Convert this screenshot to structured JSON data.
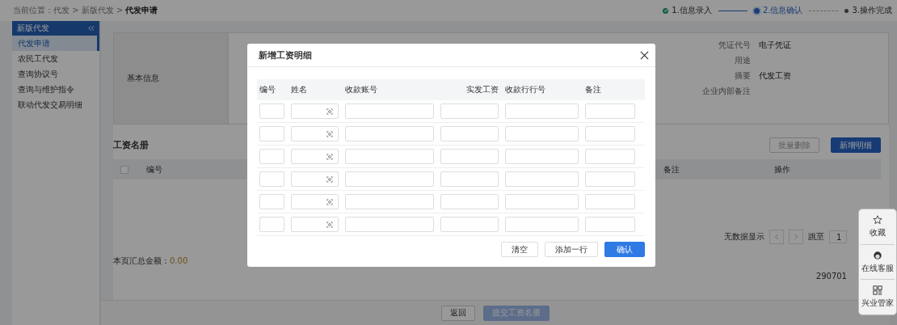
{
  "breadcrumb": {
    "trail": "当前位置：代发 > 新版代发 >",
    "current": "代发申请"
  },
  "steps": [
    {
      "label": "1.信息录入",
      "completed": true,
      "selected": false
    },
    {
      "label": "2.信息确认",
      "completed": false,
      "selected": true
    },
    {
      "label": "3.操作完成",
      "completed": false,
      "selected": false
    }
  ],
  "sidebar": {
    "title": "新版代发",
    "items": [
      {
        "label": "代发申请",
        "selected": true
      },
      {
        "label": "农民工代发",
        "selected": false
      },
      {
        "label": "查询协议号",
        "selected": false
      },
      {
        "label": "查询与维护指令",
        "selected": false
      },
      {
        "label": "联动代发交易明细",
        "selected": false
      }
    ]
  },
  "basic_info": {
    "label": "基本信息",
    "fields": [
      {
        "label": "凭证代号",
        "value": "电子凭证"
      },
      {
        "label": "用途"
      },
      {
        "label": "摘要",
        "value": "代发工资"
      },
      {
        "label": "企业内部备注"
      }
    ]
  },
  "payroll": {
    "title": "工资名册",
    "buttons": [
      {
        "label": "批量删除",
        "disabled": true
      },
      {
        "label": "新增明细",
        "disabled": false
      }
    ],
    "select_all_checked": false,
    "columns": [
      "编号",
      "备注",
      "操作"
    ],
    "pagination": {
      "status": "无数据显示",
      "jump_label": "跳至",
      "page": "1"
    },
    "total": {
      "label": "本页汇总金额：",
      "amount": "0.00"
    },
    "side_code": "290701"
  },
  "footer_buttons": [
    {
      "label": "返回",
      "kind": "default",
      "disabled": false
    },
    {
      "label": "提交工资名册",
      "kind": "primary",
      "disabled": true
    }
  ],
  "float_panel": [
    {
      "label": "收藏",
      "kind": "star"
    },
    {
      "label": "在线客服",
      "kind": "agent"
    },
    {
      "label": "兴业管家",
      "kind": "grid"
    }
  ],
  "modal": {
    "title": "新增工资明细",
    "columns": [
      "编号",
      "姓名",
      "收款账号",
      "实发工资",
      "收款行行号",
      "备注"
    ],
    "rows": [
      {
        "kind": "input"
      },
      {
        "kind": "input"
      },
      {
        "kind": "input"
      },
      {
        "kind": "input"
      },
      {
        "kind": "input"
      },
      {
        "kind": "input"
      }
    ],
    "buttons": [
      {
        "label": "清空",
        "kind": "default"
      },
      {
        "label": "添加一行",
        "kind": "default"
      },
      {
        "label": "确认",
        "kind": "primary"
      }
    ]
  }
}
